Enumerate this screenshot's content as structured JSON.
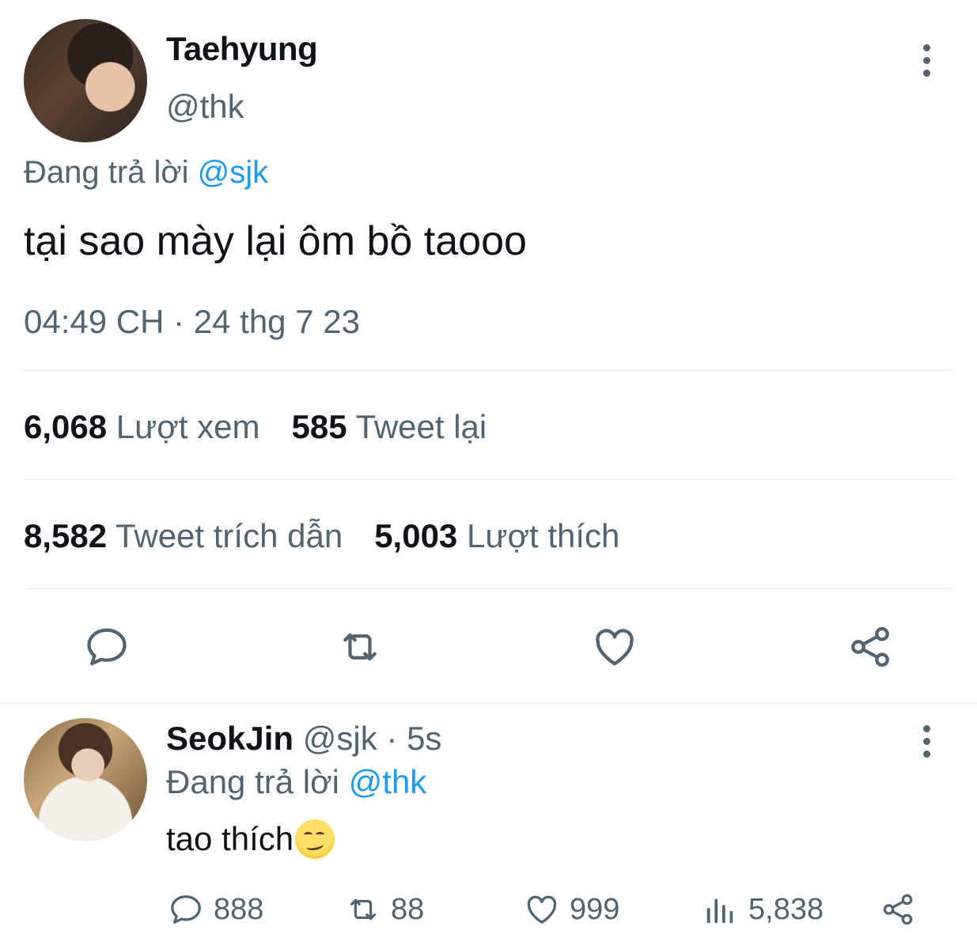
{
  "main_tweet": {
    "display_name": "Taehyung",
    "handle": "@thk",
    "reply_prefix": "Đang trả lời",
    "reply_to": "@sjk",
    "text": "tại sao mày lại ôm bồ taooo",
    "timestamp": "04:49 CH · 24 thg 7 23",
    "stats": {
      "views_count": "6,068",
      "views_label": "Lượt xem",
      "retweets_count": "585",
      "retweets_label": "Tweet lại",
      "quotes_count": "8,582",
      "quotes_label": "Tweet trích dẫn",
      "likes_count": "5,003",
      "likes_label": "Lượt thích"
    },
    "actions": [
      "reply-icon",
      "retweet-icon",
      "like-icon",
      "share-icon"
    ]
  },
  "reply_tweet": {
    "display_name": "SeokJin",
    "handle": "@sjk",
    "separator": "·",
    "time_ago": "5s",
    "reply_prefix": "Đang trả lời",
    "reply_to": "@thk",
    "text": "tao thích",
    "emoji": "smirking-face",
    "counts": {
      "replies": "888",
      "retweets": "88",
      "likes": "999",
      "views": "5,838"
    }
  },
  "colors": {
    "text": "#0f1419",
    "muted": "#536471",
    "link": "#1d9bf0",
    "divider": "#eff3f4"
  }
}
